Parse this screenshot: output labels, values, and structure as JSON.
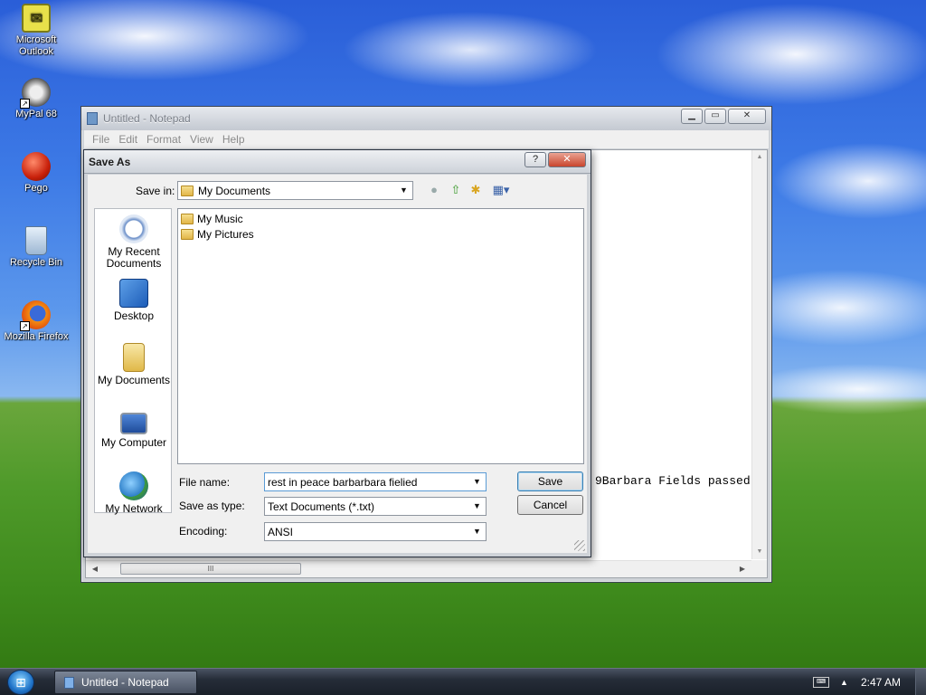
{
  "desktop": {
    "icons": [
      {
        "label": "Microsoft Outlook",
        "icon": "outlook-icon"
      },
      {
        "label": "MyPal 68",
        "icon": "mypal-raccoon-icon"
      },
      {
        "label": "Pego",
        "icon": "pego-icon"
      },
      {
        "label": "Recycle Bin",
        "icon": "recycle-bin-icon"
      },
      {
        "label": "Mozilla Firefox",
        "icon": "firefox-icon"
      }
    ]
  },
  "notepad": {
    "title": "Untitled - Notepad",
    "menu": [
      "File",
      "Edit",
      "Format",
      "View",
      "Help"
    ],
    "text": "9Barbara Fields passed",
    "hscroll_grip": "III"
  },
  "dialog": {
    "title": "Save As",
    "help": "?",
    "close": "✕",
    "save_in_label": "Save in:",
    "save_in_value": "My Documents",
    "places": [
      {
        "label": "My Recent Documents",
        "icon": "recent-documents-icon"
      },
      {
        "label": "Desktop",
        "icon": "desktop-icon"
      },
      {
        "label": "My Documents",
        "icon": "my-documents-icon"
      },
      {
        "label": "My Computer",
        "icon": "my-computer-icon"
      },
      {
        "label": "My Network",
        "icon": "my-network-icon"
      }
    ],
    "files": [
      "My Music",
      "My Pictures"
    ],
    "file_name_label": "File name:",
    "file_name_value": "rest in peace barbarbara fielied",
    "save_as_type_label": "Save as type:",
    "save_as_type_value": "Text Documents (*.txt)",
    "encoding_label": "Encoding:",
    "encoding_value": "ANSI",
    "save_button": "Save",
    "cancel_button": "Cancel"
  },
  "taskbar": {
    "task_label": "Untitled - Notepad",
    "clock": "2:47 AM"
  }
}
